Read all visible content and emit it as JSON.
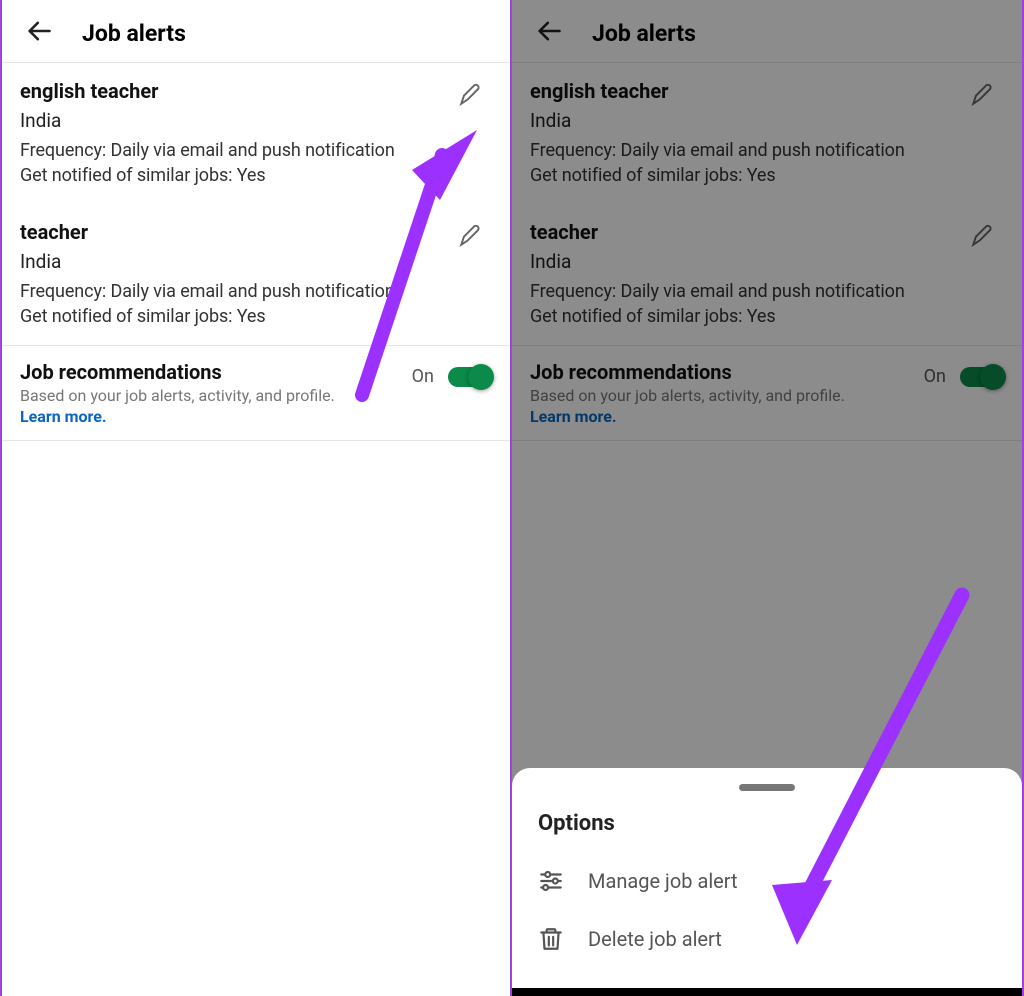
{
  "header": {
    "title": "Job alerts"
  },
  "alerts": [
    {
      "title": "english teacher",
      "location": "India",
      "frequency": "Frequency: Daily via email and push notification",
      "similar": "Get notified of similar jobs: Yes"
    },
    {
      "title": "teacher",
      "location": "India",
      "frequency": "Frequency: Daily via email and push notification",
      "similar": "Get notified of similar jobs: Yes"
    }
  ],
  "recommendations": {
    "title": "Job recommendations",
    "subtitle": "Based on your job alerts, activity, and profile.",
    "learn_more": "Learn more.",
    "state_label": "On"
  },
  "sheet": {
    "title": "Options",
    "manage": "Manage job alert",
    "delete": "Delete job alert"
  },
  "annotation": {
    "arrow_color": "#9b30ff"
  }
}
